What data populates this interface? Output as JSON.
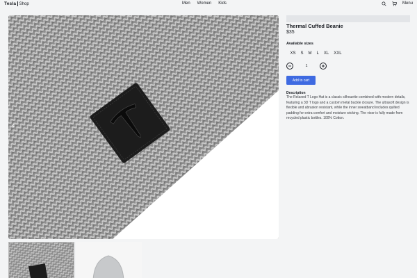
{
  "header": {
    "brand": "Tesla",
    "shop": "Shop",
    "nav": [
      "Men",
      "Women",
      "Kids"
    ],
    "menu_label": "Menu",
    "icons": [
      "search-icon",
      "cart-icon"
    ]
  },
  "product": {
    "title": "Thermal Cuffed Beanie",
    "price": "$35",
    "sizes_label": "Available sizes",
    "sizes": [
      "XS",
      "S",
      "M",
      "L",
      "XL",
      "XXL"
    ],
    "quantity": "1",
    "add_to_cart": "Add to cart",
    "description_label": "Description",
    "description": "The Relaxed T Logo Hat is a classic silhouette combined with modern details, featuring a 3D T logo and a custom metal buckle closure. The ultrasoft design is flexible and abrasion resistant, while the inner sweatband includes quilted padding for extra comfort and moisture wicking. The visor is fully made from recycled plastic bottles. 100% Cotton."
  },
  "gallery": {
    "thumbnails": [
      "beanie-closeup-thumbnail",
      "beanie-full-thumbnail"
    ],
    "arrows": [
      "chevron-left-icon",
      "chevron-right-icon"
    ]
  },
  "colors": {
    "accent": "#3e6ae1",
    "text": "#171a20",
    "background": "#f3f4f5"
  }
}
